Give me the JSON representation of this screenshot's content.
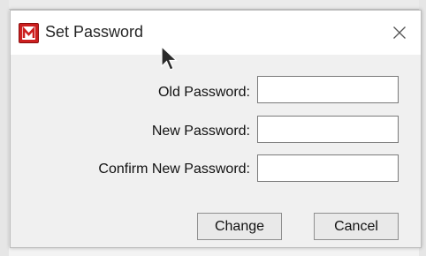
{
  "dialog": {
    "title": "Set Password",
    "icon": "app-logo-m-icon",
    "close_icon": "close-icon"
  },
  "form": {
    "old_password": {
      "label": "Old Password:",
      "value": ""
    },
    "new_password": {
      "label": "New Password:",
      "value": ""
    },
    "confirm_password": {
      "label": "Confirm New Password:",
      "value": ""
    }
  },
  "buttons": {
    "change_label": "Change",
    "cancel_label": "Cancel"
  },
  "colors": {
    "app_icon_red": "#cc1f1f"
  }
}
